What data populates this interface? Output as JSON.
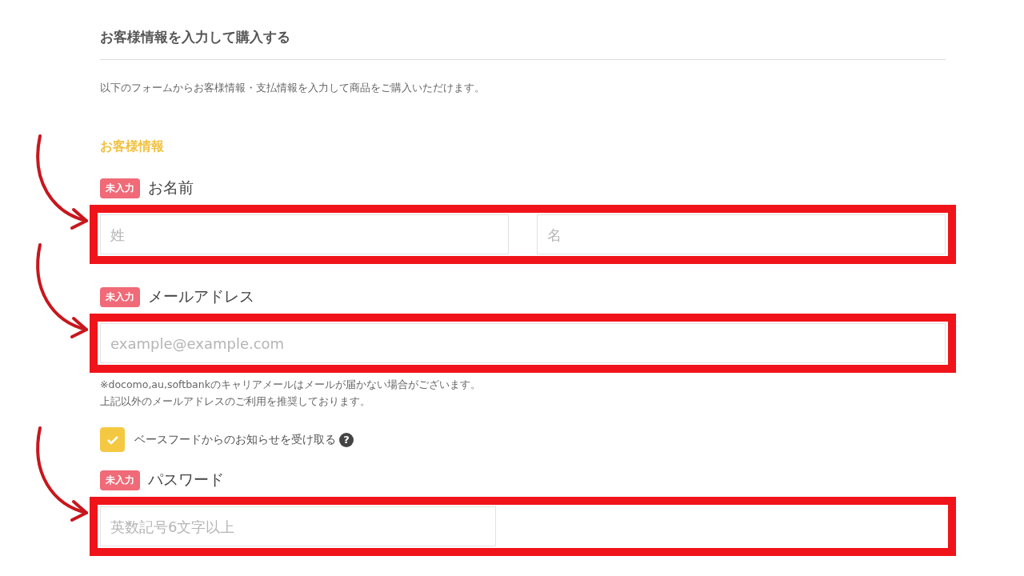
{
  "title": "お客様情報を入力して購入する",
  "intro": "以下のフォームからお客様情報・支払情報を入力して商品をご購入いただけます。",
  "section_heading": "お客様情報",
  "items": [
    {
      "kind": "field",
      "badge": "未入力",
      "label": "お名前",
      "highlighted": true,
      "inputs": [
        {
          "placeholder": "姓"
        },
        {
          "placeholder": "名"
        }
      ]
    },
    {
      "kind": "field",
      "badge": "未入力",
      "label": "メールアドレス",
      "highlighted": true,
      "inputs": [
        {
          "placeholder": "example@example.com"
        }
      ],
      "notes": [
        "※docomo,au,softbankのキャリアメールはメールが届かない場合がございます。",
        "上記以外のメールアドレスのご利用を推奨しております。"
      ]
    },
    {
      "kind": "checkbox",
      "label": "ベースフードからのお知らせを受け取る",
      "checked": true,
      "help": "?"
    },
    {
      "kind": "field",
      "badge": "未入力",
      "label": "パスワード",
      "highlighted": true,
      "inputs": [
        {
          "placeholder": "英数記号6文字以上"
        }
      ],
      "half": true
    }
  ]
}
